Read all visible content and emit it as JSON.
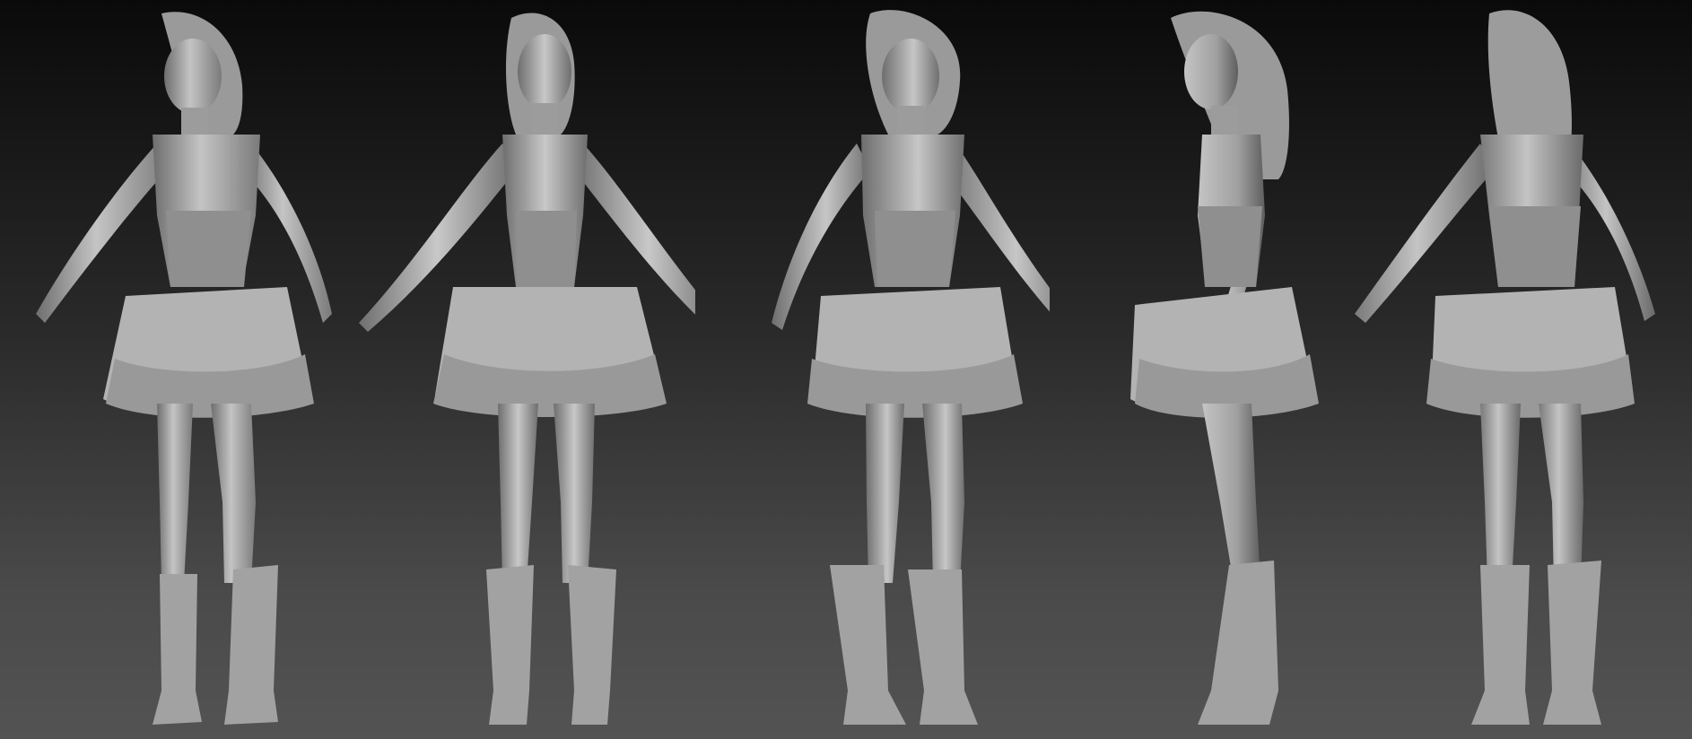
{
  "scene": {
    "background": {
      "top": "#0a0a0a",
      "bottom": "#535353"
    },
    "model_color": "#a9a9a9",
    "model_shadow": "#6e6e6e",
    "model_highlight": "#d6d6d6",
    "views": [
      {
        "angle": "three-quarter-left"
      },
      {
        "angle": "front"
      },
      {
        "angle": "three-quarter-right"
      },
      {
        "angle": "side-left"
      },
      {
        "angle": "back-three-quarter"
      }
    ]
  }
}
